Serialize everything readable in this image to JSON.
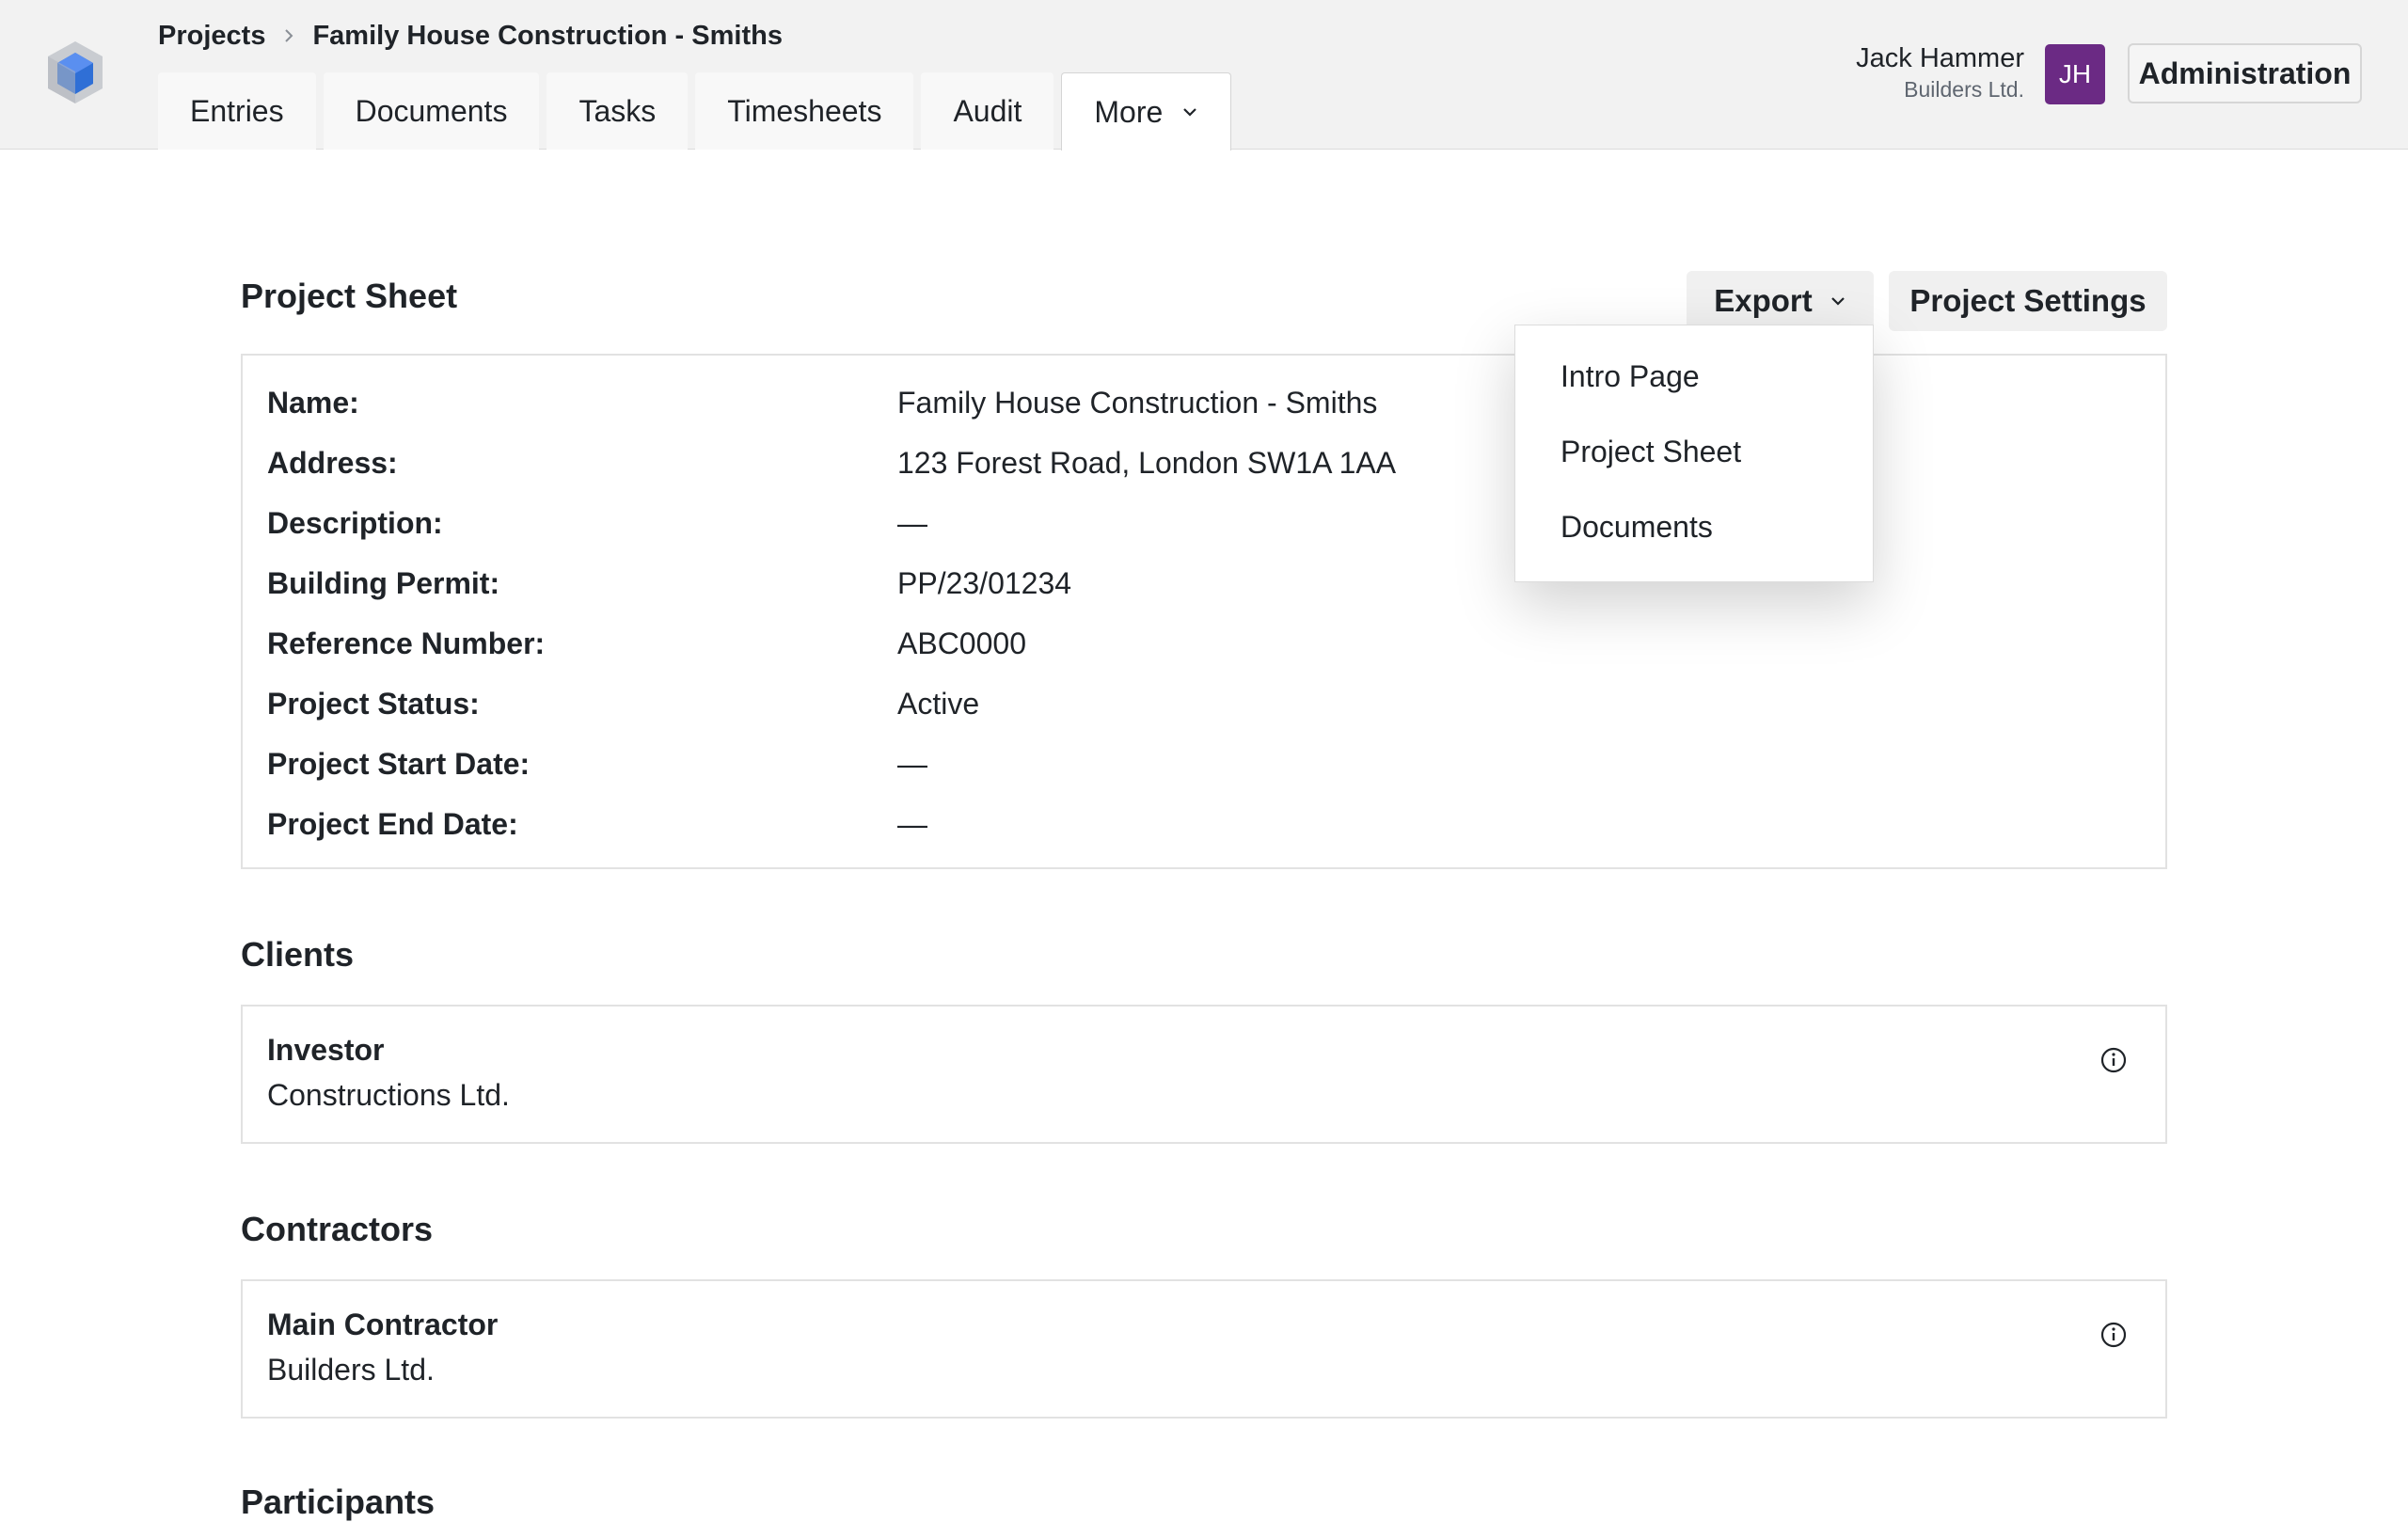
{
  "breadcrumb": {
    "root": "Projects",
    "current": "Family House Construction - Smiths"
  },
  "tabs": [
    "Entries",
    "Documents",
    "Tasks",
    "Timesheets",
    "Audit",
    "More"
  ],
  "user": {
    "name": "Jack Hammer",
    "company": "Builders Ltd.",
    "initials": "JH"
  },
  "header": {
    "admin_label": "Administration"
  },
  "sheet": {
    "title": "Project Sheet",
    "export_label": "Export",
    "settings_label": "Project Settings",
    "rows": [
      {
        "label": "Name:",
        "value": "Family House Construction - Smiths"
      },
      {
        "label": "Address:",
        "value": "123 Forest Road, London SW1A 1AA"
      },
      {
        "label": "Description:",
        "value": "—"
      },
      {
        "label": "Building Permit:",
        "value": "PP/23/01234"
      },
      {
        "label": "Reference Number:",
        "value": "ABC0000"
      },
      {
        "label": "Project Status:",
        "value": "Active"
      },
      {
        "label": "Project Start Date:",
        "value": "—"
      },
      {
        "label": "Project End Date:",
        "value": "—"
      }
    ]
  },
  "export_menu": [
    "Intro Page",
    "Project Sheet",
    "Documents"
  ],
  "clients": {
    "title": "Clients",
    "role": "Investor",
    "org": "Constructions Ltd."
  },
  "contractors": {
    "title": "Contractors",
    "role": "Main Contractor",
    "org": "Builders Ltd."
  },
  "participants": {
    "title": "Participants"
  },
  "colors": {
    "avatar": "#6b2a84",
    "logo_blue": "#2f6fd6",
    "header_bg": "#f2f2f2"
  }
}
